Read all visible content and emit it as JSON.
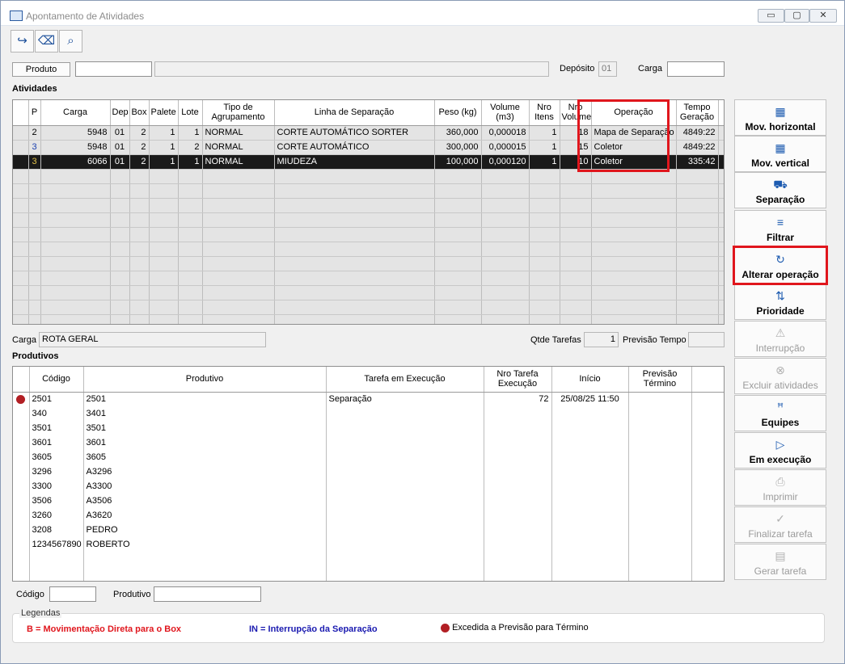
{
  "window": {
    "title": "Apontamento de Atividades",
    "controls": [
      "▭",
      "▢",
      "✕"
    ]
  },
  "toolbar": {
    "exit_icon": "exit-icon",
    "clear_icon": "eraser-icon",
    "search_icon": "search-icon"
  },
  "filters": {
    "produto_button": "Produto",
    "produto_code": "",
    "produto_desc": "",
    "deposito_label": "Depósito",
    "deposito_value": "01",
    "carga_label": "Carga",
    "carga_value": ""
  },
  "atividades": {
    "title": "Atividades",
    "columns": [
      "",
      "P",
      "Carga",
      "Dep",
      "Box",
      "Palete",
      "Lote",
      "Tipo de Agrupamento",
      "Linha de Separação",
      "Peso (kg)",
      "Volume (m3)",
      "Nro Itens",
      "Nro Volume",
      "Operação",
      "Tempo Geração",
      ""
    ],
    "rows": [
      {
        "p": "2",
        "carga": "5948",
        "dep": "01",
        "box": "2",
        "palete": "1",
        "lote": "1",
        "tipo": "NORMAL",
        "linha": "CORTE AUTOMÁTICO SORTER",
        "peso": "360,000",
        "volume": "0,000018",
        "itens": "1",
        "volumes": "18",
        "operacao": "Mapa de Separação",
        "tempo": "4849:22"
      },
      {
        "p": "3",
        "carga": "5948",
        "dep": "01",
        "box": "2",
        "palete": "1",
        "lote": "2",
        "tipo": "NORMAL",
        "linha": "CORTE AUTOMÁTICO",
        "peso": "300,000",
        "volume": "0,000015",
        "itens": "1",
        "volumes": "15",
        "operacao": "Coletor",
        "tempo": "4849:22"
      },
      {
        "p": "3",
        "carga": "6066",
        "dep": "01",
        "box": "2",
        "palete": "1",
        "lote": "1",
        "tipo": "NORMAL",
        "linha": "MIUDEZA",
        "peso": "100,000",
        "volume": "0,000120",
        "itens": "1",
        "volumes": "10",
        "operacao": "Coletor",
        "tempo": "335:42"
      }
    ]
  },
  "info": {
    "carga_label": "Carga",
    "carga_value": "ROTA GERAL",
    "qtde_label": "Qtde Tarefas",
    "qtde_value": "1",
    "previsao_label": "Previsão Tempo",
    "previsao_value": ""
  },
  "produtivos": {
    "title": "Produtivos",
    "columns": [
      "",
      "Código",
      "Produtivo",
      "Tarefa em Execução",
      "Nro Tarefa Execução",
      "Início",
      "Previsão Término",
      ""
    ],
    "rows": [
      {
        "flag": true,
        "codigo": "2501",
        "produtivo": "2501",
        "tarefa": "Separação",
        "nro": "72",
        "inicio": "25/08/25  11:50",
        "previsao": ""
      },
      {
        "flag": false,
        "codigo": "340",
        "produtivo": "3401",
        "tarefa": "",
        "nro": "",
        "inicio": "",
        "previsao": ""
      },
      {
        "flag": false,
        "codigo": "3501",
        "produtivo": "3501",
        "tarefa": "",
        "nro": "",
        "inicio": "",
        "previsao": ""
      },
      {
        "flag": false,
        "codigo": "3601",
        "produtivo": "3601",
        "tarefa": "",
        "nro": "",
        "inicio": "",
        "previsao": ""
      },
      {
        "flag": false,
        "codigo": "3605",
        "produtivo": "3605",
        "tarefa": "",
        "nro": "",
        "inicio": "",
        "previsao": ""
      },
      {
        "flag": false,
        "codigo": "3296",
        "produtivo": "A3296",
        "tarefa": "",
        "nro": "",
        "inicio": "",
        "previsao": ""
      },
      {
        "flag": false,
        "codigo": "3300",
        "produtivo": "A3300",
        "tarefa": "",
        "nro": "",
        "inicio": "",
        "previsao": ""
      },
      {
        "flag": false,
        "codigo": "3506",
        "produtivo": "A3506",
        "tarefa": "",
        "nro": "",
        "inicio": "",
        "previsao": ""
      },
      {
        "flag": false,
        "codigo": "3260",
        "produtivo": "A3620",
        "tarefa": "",
        "nro": "",
        "inicio": "",
        "previsao": ""
      },
      {
        "flag": false,
        "codigo": "3208",
        "produtivo": "PEDRO",
        "tarefa": "",
        "nro": "",
        "inicio": "",
        "previsao": ""
      },
      {
        "flag": false,
        "codigo": "1234567890",
        "produtivo": "ROBERTO",
        "tarefa": "",
        "nro": "",
        "inicio": "",
        "previsao": ""
      }
    ]
  },
  "bottom": {
    "codigo_label": "Código",
    "codigo_value": "",
    "produtivo_label": "Produtivo",
    "produtivo_value": ""
  },
  "legend": {
    "title": "Legendas",
    "b": "B = Movimentação Direta para o Box",
    "in": "IN = Interrupção da Separação",
    "excedida": "Excedida a Previsão para Término",
    "b_color": "#e0161d",
    "in_color": "#1a1ab0",
    "dot_color": "#b21f24"
  },
  "sidebar": [
    {
      "label": "Mov. horizontal",
      "icon": "grid-icon",
      "glyph": "▦",
      "enabled": true
    },
    {
      "label": "Mov. vertical",
      "icon": "grid-icon",
      "glyph": "▦",
      "enabled": true
    },
    {
      "label": "Separação",
      "icon": "hand-truck-icon",
      "glyph": "⛟",
      "enabled": true
    },
    {
      "label": "Filtrar",
      "icon": "filter-icon",
      "glyph": "≡",
      "enabled": true
    },
    {
      "label": "Alterar operação",
      "icon": "refresh-icon",
      "glyph": "↻",
      "enabled": true
    },
    {
      "label": "Prioridade",
      "icon": "sort-arrows-icon",
      "glyph": "⇅",
      "enabled": true
    },
    {
      "label": "Interrupção",
      "icon": "warning-icon",
      "glyph": "⚠",
      "enabled": false
    },
    {
      "label": "Excluir atividades",
      "icon": "cancel-circle-icon",
      "glyph": "⊗",
      "enabled": false
    },
    {
      "label": "Equipes",
      "icon": "people-icon",
      "glyph": "ꟸ",
      "enabled": true
    },
    {
      "label": "Em execução",
      "icon": "play-icon",
      "glyph": "▷",
      "enabled": true
    },
    {
      "label": "Imprimir",
      "icon": "printer-icon",
      "glyph": "⎙",
      "enabled": false
    },
    {
      "label": "Finalizar tarefa",
      "icon": "check-circle-icon",
      "glyph": "✓",
      "enabled": false
    },
    {
      "label": "Gerar tarefa",
      "icon": "document-icon",
      "glyph": "▤",
      "enabled": false
    }
  ]
}
